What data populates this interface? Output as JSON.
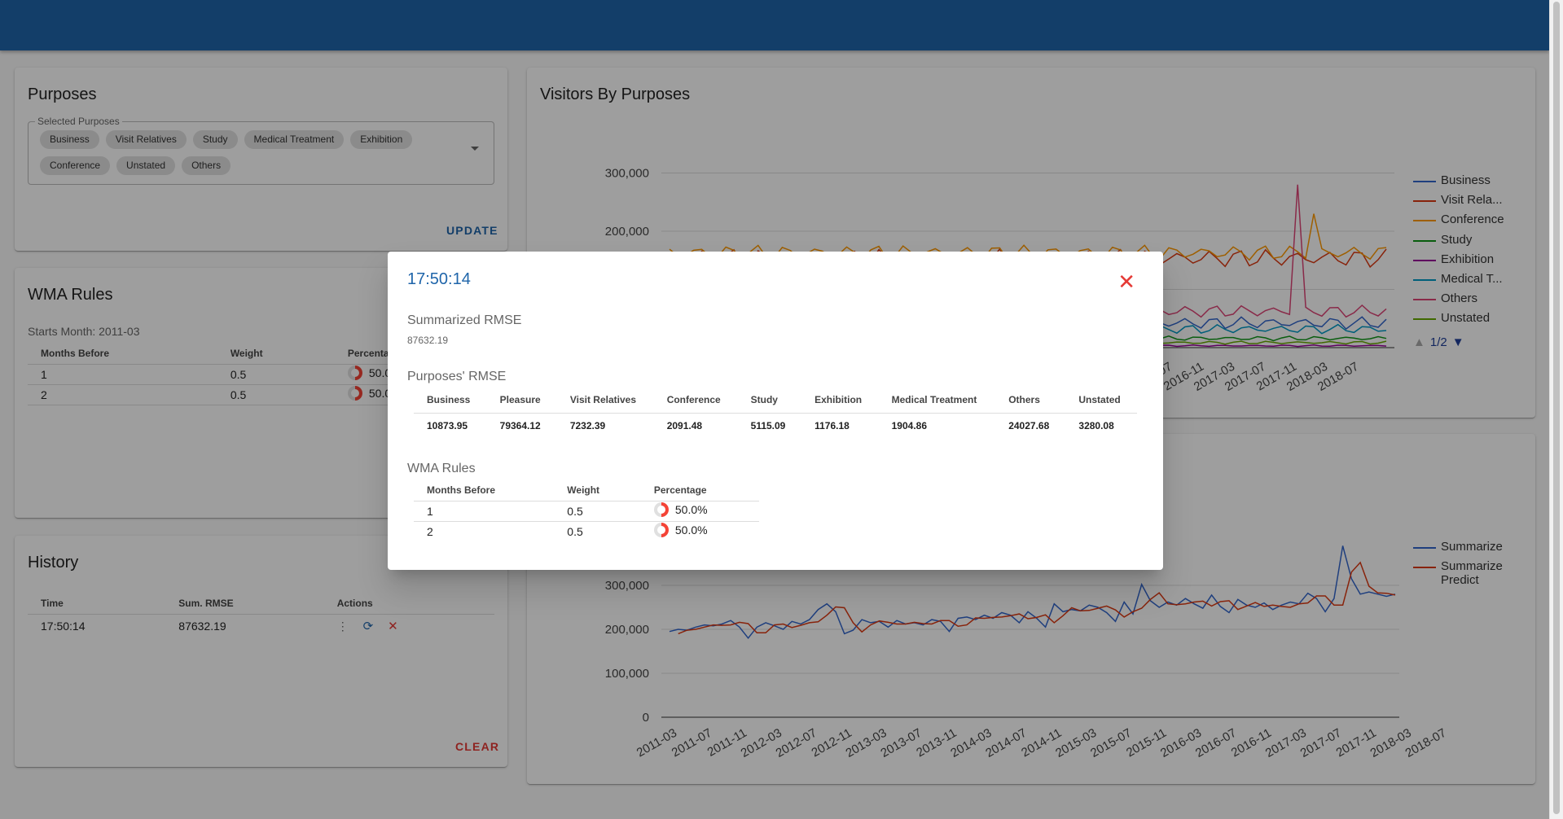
{
  "purposes": {
    "title": "Purposes",
    "selected_label": "Selected Purposes",
    "chips": [
      "Business",
      "Visit Relatives",
      "Study",
      "Medical Treatment",
      "Exhibition",
      "Conference",
      "Unstated",
      "Others"
    ],
    "update_label": "UPDATE"
  },
  "wma": {
    "title": "WMA Rules",
    "starts_month": "Starts Month: 2011-03",
    "headers": [
      "Months Before",
      "Weight",
      "Percentage"
    ],
    "rows": [
      {
        "months": "1",
        "weight": "0.5",
        "percentage": "50.0%"
      },
      {
        "months": "2",
        "weight": "0.5",
        "percentage": "50.0%"
      }
    ]
  },
  "history": {
    "title": "History",
    "headers": [
      "Time",
      "Sum. RMSE",
      "Actions"
    ],
    "rows": [
      {
        "time": "17:50:14",
        "rmse": "87632.19"
      }
    ],
    "clear_label": "CLEAR"
  },
  "chart1_card": {
    "title": "Visitors By Purposes",
    "legend": [
      "Business",
      "Visit Rela...",
      "Conference",
      "Study",
      "Exhibition",
      "Medical T...",
      "Others",
      "Unstated"
    ],
    "legend_colors": [
      "#3366cc",
      "#dc3912",
      "#ff9900",
      "#109618",
      "#990099",
      "#0099c6",
      "#dd4477",
      "#66aa00"
    ],
    "pager": "1/2"
  },
  "chart2_card": {
    "legend": [
      "Summarize",
      "Summarize Predict"
    ],
    "legend_colors": [
      "#3366cc",
      "#dc3912"
    ]
  },
  "dialog": {
    "title": "17:50:14",
    "summary_label": "Summarized RMSE",
    "summary_value": "87632.19",
    "purposes_label": "Purposes' RMSE",
    "purposes_headers": [
      "Business",
      "Pleasure",
      "Visit Relatives",
      "Conference",
      "Study",
      "Exhibition",
      "Medical Treatment",
      "Others",
      "Unstated"
    ],
    "purposes_values": [
      "10873.95",
      "79364.12",
      "7232.39",
      "2091.48",
      "5115.09",
      "1176.18",
      "1904.86",
      "24027.68",
      "3280.08"
    ],
    "wma_label": "WMA Rules",
    "wma_headers": [
      "Months Before",
      "Weight",
      "Percentage"
    ],
    "wma_rows": [
      {
        "months": "1",
        "weight": "0.5",
        "percentage": "50.0%"
      },
      {
        "months": "2",
        "weight": "0.5",
        "percentage": "50.0%"
      }
    ]
  },
  "chart_data": [
    {
      "type": "line",
      "title": "Visitors By Purposes",
      "y_ticks": [
        "300,000",
        "200,000"
      ],
      "x_ticks_visible": [
        "2016-07",
        "2016-11",
        "2017-03",
        "2017-07",
        "2017-11",
        "2018-03",
        "2018-07"
      ],
      "series": [
        {
          "name": "Business"
        },
        {
          "name": "Visit Relatives"
        },
        {
          "name": "Conference"
        },
        {
          "name": "Study"
        },
        {
          "name": "Exhibition"
        },
        {
          "name": "Medical Treatment"
        },
        {
          "name": "Others"
        },
        {
          "name": "Unstated"
        }
      ]
    },
    {
      "type": "line",
      "ylim": [
        0,
        350000
      ],
      "y_ticks": [
        "300,000",
        "200,000",
        "100,000",
        "0"
      ],
      "x_ticks": [
        "2011-03",
        "2011-07",
        "2011-11",
        "2012-03",
        "2012-07",
        "2012-11",
        "2013-03",
        "2013-07",
        "2013-11",
        "2014-03",
        "2014-07",
        "2014-11",
        "2015-03",
        "2015-07",
        "2015-11",
        "2016-03",
        "2016-07",
        "2016-11",
        "2017-03",
        "2017-07",
        "2017-11",
        "2018-03",
        "2018-07"
      ],
      "series": [
        {
          "name": "Summarize",
          "values": [
            195000,
            200000,
            198000,
            205000,
            210000,
            208000,
            212000,
            220000,
            205000,
            180000,
            205000,
            215000,
            208000,
            200000,
            218000,
            212000,
            222000,
            245000,
            258000,
            240000,
            190000,
            198000,
            222000,
            215000,
            218000,
            205000,
            220000,
            212000,
            215000,
            210000,
            222000,
            218000,
            195000,
            225000,
            228000,
            222000,
            232000,
            225000,
            238000,
            232000,
            215000,
            240000,
            225000,
            205000,
            258000,
            240000,
            245000,
            242000,
            255000,
            250000,
            238000,
            218000,
            262000,
            235000,
            302000,
            265000,
            250000,
            262000,
            255000,
            270000,
            258000,
            248000,
            278000,
            252000,
            238000,
            268000,
            255000,
            250000,
            260000,
            245000,
            255000,
            262000,
            258000,
            282000,
            270000,
            240000,
            270000,
            390000,
            315000,
            280000,
            285000,
            280000,
            275000,
            280000
          ]
        },
        {
          "name": "Summarize Predict",
          "values": [
            null,
            190000,
            198000,
            200000,
            205000,
            210000,
            209000,
            210000,
            216000,
            213000,
            192000,
            192000,
            210000,
            212000,
            204000,
            209000,
            215000,
            217000,
            232000,
            251000,
            249000,
            215000,
            194000,
            210000,
            219000,
            216000,
            212000,
            212000,
            216000,
            213000,
            212000,
            220000,
            220000,
            207000,
            210000,
            226000,
            225000,
            227000,
            228000,
            231000,
            235000,
            224000,
            227000,
            233000,
            215000,
            231000,
            249000,
            242000,
            243000,
            248000,
            253000,
            244000,
            228000,
            240000,
            248000,
            268000,
            283000,
            258000,
            256000,
            258000,
            262000,
            264000,
            253000,
            263000,
            265000,
            245000,
            253000,
            261000,
            252000,
            255000,
            252000,
            250000,
            258000,
            260000,
            276000,
            276000,
            255000,
            255000,
            330000,
            352000,
            298000,
            283000,
            282000,
            278000
          ]
        }
      ]
    }
  ]
}
